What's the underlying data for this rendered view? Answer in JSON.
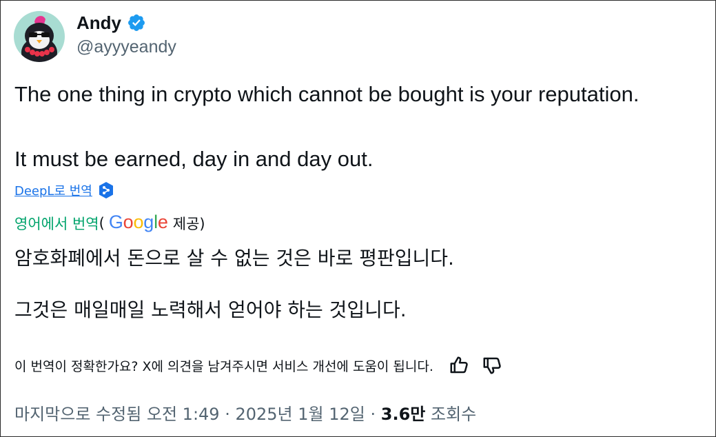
{
  "author": {
    "name": "Andy",
    "handle": "@ayyyeandy",
    "verified": true,
    "avatar_icon": "penguin-avatar-icon",
    "verified_icon": "verified-badge-icon"
  },
  "tweet": {
    "line1": "The one thing in crypto which cannot be bought is your reputation.",
    "line2": "It must be earned, day in and day out."
  },
  "deepl": {
    "label": "DeepL로 번역",
    "icon": "deepl-icon"
  },
  "google_translate": {
    "label": "영어에서 번역",
    "open_paren": "(",
    "logo_letters": [
      "G",
      "o",
      "o",
      "g",
      "l",
      "e"
    ],
    "provider_suffix": "제공)"
  },
  "translation": {
    "line1": "암호화폐에서 돈으로 살 수 없는 것은 바로 평판입니다.",
    "line2": "그것은 매일매일 노력해서 얻어야 하는 것입니다."
  },
  "feedback": {
    "prompt": "이 번역이 정확한가요? X에 의견을 남겨주시면 서비스 개선에 도움이 됩니다.",
    "thumbs_up_icon": "thumbs-up-icon",
    "thumbs_down_icon": "thumbs-down-icon"
  },
  "meta": {
    "edited_time": "마지막으로 수정됨 오전 1:49 · 2025년 1월 12일 · ",
    "views_count": "3.6만",
    "views_label": " 조회수"
  },
  "colors": {
    "verified": "#1d9bf0",
    "deepl": "#0f2b46",
    "link": "#1a73e8",
    "google_translate_label": "#00a36b",
    "secondary_text": "#536471"
  }
}
